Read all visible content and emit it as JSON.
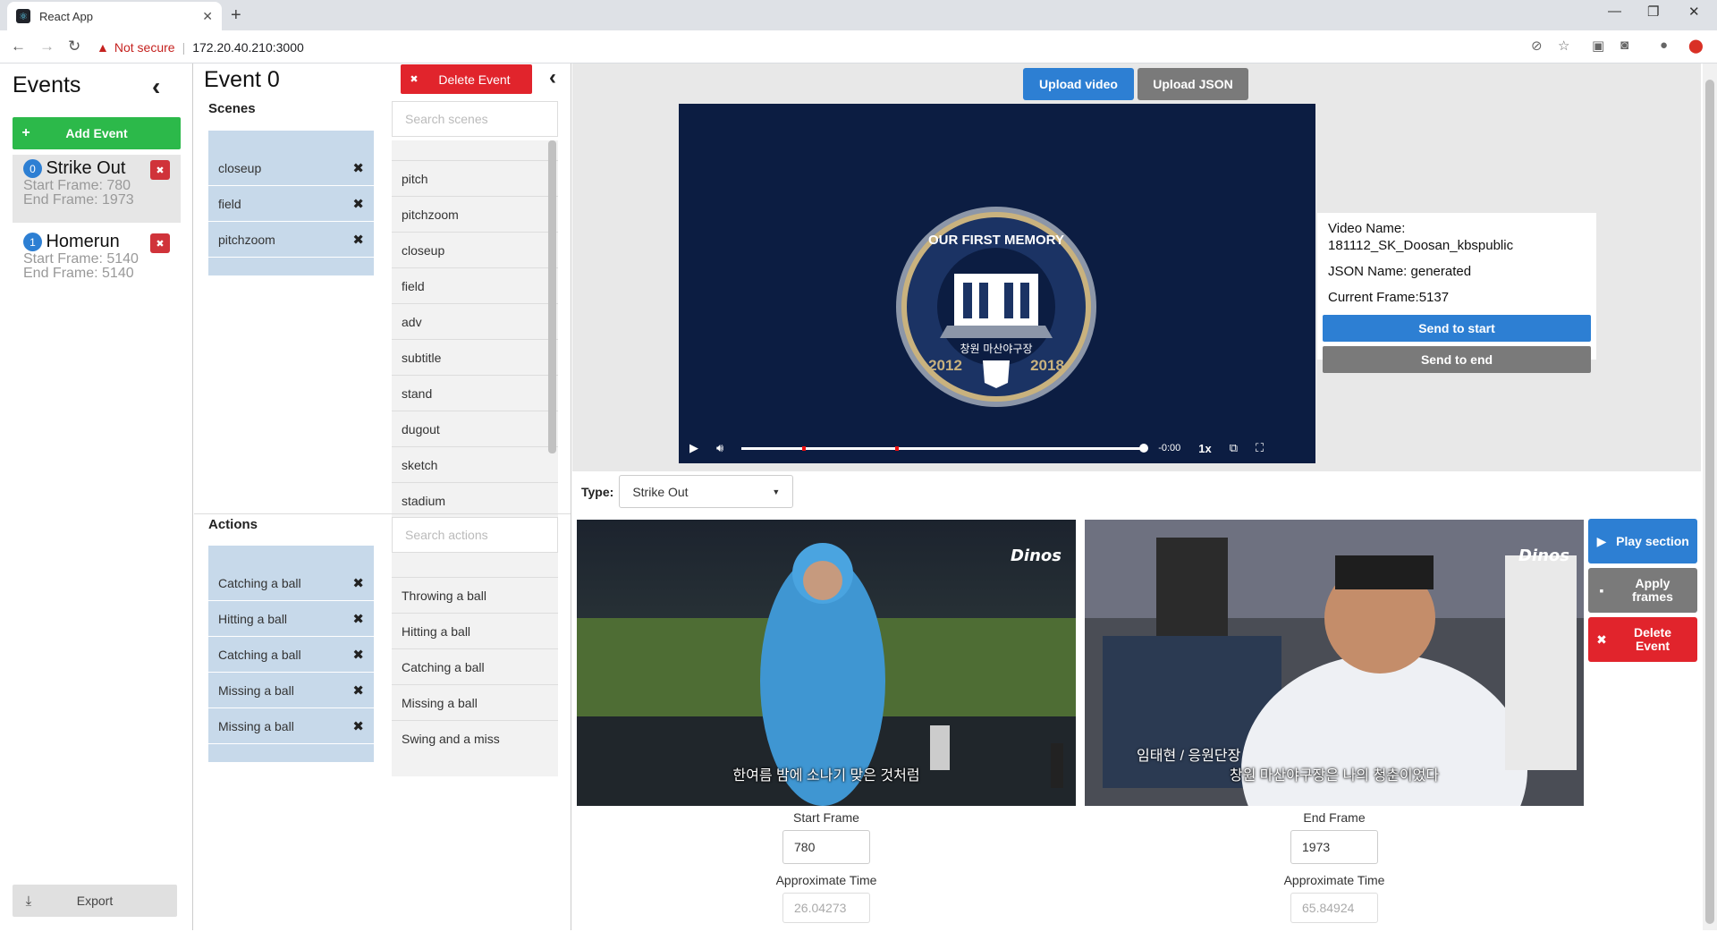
{
  "browser": {
    "tab_title": "React App",
    "not_secure": "Not secure",
    "url": "172.20.40.210:3000"
  },
  "events_panel": {
    "title": "Events",
    "add_label": "Add Event",
    "export_label": "Export",
    "items": [
      {
        "index": "0",
        "name": "Strike Out",
        "start": "Start Frame: 780",
        "end": "End Frame: 1973"
      },
      {
        "index": "1",
        "name": "Homerun",
        "start": "Start Frame: 5140",
        "end": "End Frame: 5140"
      }
    ]
  },
  "detail": {
    "title": "Event 0",
    "delete_label": "Delete Event",
    "scenes_title": "Scenes",
    "scenes_search_placeholder": "Search scenes",
    "scenes_selected": [
      "closeup",
      "field",
      "pitchzoom"
    ],
    "scenes_options": [
      "pitch",
      "pitchzoom",
      "closeup",
      "field",
      "adv",
      "subtitle",
      "stand",
      "dugout",
      "sketch",
      "stadium"
    ],
    "actions_title": "Actions",
    "actions_search_placeholder": "Search actions",
    "actions_selected": [
      "Catching a ball",
      "Hitting a ball",
      "Catching a ball",
      "Missing a ball",
      "Missing a ball"
    ],
    "actions_options": [
      "Throwing a ball",
      "Hitting a ball",
      "Catching a ball",
      "Missing a ball",
      "Swing and a miss"
    ]
  },
  "player": {
    "upload_video": "Upload video",
    "upload_json": "Upload JSON",
    "time": "-0:00",
    "speed": "1x",
    "badge_top": "OUR FIRST MEMORY",
    "badge_mid": "창원 마산야구장",
    "badge_left_year": "2012",
    "badge_right_year": "2018"
  },
  "info": {
    "video_name": "Video Name: 181112_SK_Doosan_kbspublic",
    "json_name": "JSON Name: generated",
    "current_frame": "Current Frame:5137",
    "send_start": "Send to start",
    "send_end": "Send to end"
  },
  "editor": {
    "type_label": "Type:",
    "type_value": "Strike Out",
    "start_caption": "한여름 밤에 소나기 맞은 것처럼",
    "end_caption_name": "임태현 / 응원단장",
    "end_caption": "창원 마산야구장은 나의 청춘이었다",
    "logo": "Dinos",
    "start_frame_label": "Start Frame",
    "start_frame_value": "780",
    "end_frame_label": "End Frame",
    "end_frame_value": "1973",
    "approx_label": "Approximate Time",
    "start_approx": "26.04273",
    "end_approx": "65.84924",
    "play_section": "Play section",
    "apply_frames": "Apply frames",
    "delete_event": "Delete Event"
  },
  "colors": {
    "blue": "#2d7fd3",
    "green": "#2cb94a",
    "red": "#e1242c",
    "gray_button": "#7a7a7a",
    "selected_bg": "#c7d9ea",
    "video_bg": "#0c1d42"
  }
}
